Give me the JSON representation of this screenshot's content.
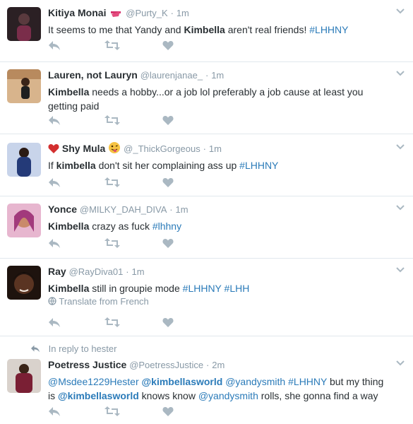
{
  "tweets": [
    {
      "name": "Kitiya Monai",
      "handle": "@Purty_K",
      "time": "1m",
      "avatar_color": "#4a2c33",
      "segments": [
        {
          "t": "It seems to me that Yandy and ",
          "k": "text"
        },
        {
          "t": "Kimbella",
          "k": "bold"
        },
        {
          "t": " aren't real friends!  ",
          "k": "text"
        },
        {
          "t": "#LHHNY",
          "k": "tag"
        }
      ]
    },
    {
      "name": "Lauren, not Lauryn",
      "handle": "@laurenjanae_",
      "time": "1m",
      "avatar_color": "#c9a27a",
      "segments": [
        {
          "t": "Kimbella",
          "k": "bold"
        },
        {
          "t": " needs a hobby...or a job lol preferably a job cause at least you getting paid",
          "k": "text"
        }
      ]
    },
    {
      "name": "Shy Mula",
      "handle": "@_ThickGorgeous",
      "time": "1m",
      "avatar_color": "#2a3a6a",
      "segments": [
        {
          "t": "If ",
          "k": "text"
        },
        {
          "t": "kimbella",
          "k": "bold"
        },
        {
          "t": " don't sit her complaining ass up  ",
          "k": "text"
        },
        {
          "t": "#LHHNY",
          "k": "tag"
        }
      ]
    },
    {
      "name": "Yonce",
      "handle": "@MILKY_DAH_DIVA",
      "time": "1m",
      "avatar_color": "#c0709a",
      "segments": [
        {
          "t": "Kimbella",
          "k": "bold"
        },
        {
          "t": " crazy as fuck ",
          "k": "text"
        },
        {
          "t": "#lhhny",
          "k": "tag"
        }
      ]
    },
    {
      "name": "Ray",
      "handle": "@RayDiva01",
      "time": "1m",
      "avatar_color": "#3b2418",
      "segments": [
        {
          "t": "Kimbella",
          "k": "bold"
        },
        {
          "t": " still in groupie mode ",
          "k": "text"
        },
        {
          "t": "#LHHNY",
          "k": "tag"
        },
        {
          "t": " ",
          "k": "text"
        },
        {
          "t": "#LHH",
          "k": "tag"
        }
      ],
      "translate_label": "Translate from French"
    },
    {
      "reply_context": "In reply to hester",
      "name": "Poetress Justice",
      "handle": "@PoetressJustice",
      "time": "2m",
      "avatar_color": "#6b1f2e",
      "segments": [
        {
          "t": "@Msdee1229Hester",
          "k": "mention"
        },
        {
          "t": " ",
          "k": "text"
        },
        {
          "t": "@kimbellasworld",
          "k": "mention-bold"
        },
        {
          "t": " ",
          "k": "text"
        },
        {
          "t": "@yandysmith",
          "k": "mention"
        },
        {
          "t": " ",
          "k": "text"
        },
        {
          "t": "#LHHNY",
          "k": "tag"
        },
        {
          "t": " but my thing is ",
          "k": "text"
        },
        {
          "t": "@kimbellasworld",
          "k": "mention-bold"
        },
        {
          "t": " knows know ",
          "k": "text"
        },
        {
          "t": "@yandysmith",
          "k": "mention"
        },
        {
          "t": " rolls, she gonna find a way",
          "k": "text"
        }
      ]
    }
  ],
  "colors": {
    "link": "#2b7bb9",
    "muted": "#8899a6",
    "icon": "#aab8c2",
    "divider": "#e1e8ed"
  },
  "icons": {
    "reply": "reply-icon",
    "retweet": "retweet-icon",
    "like": "like-icon",
    "caret": "chevron-down-icon",
    "globe": "globe-icon"
  }
}
